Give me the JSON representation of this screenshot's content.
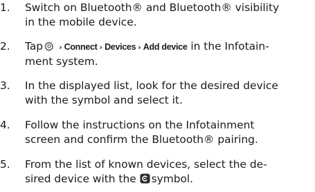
{
  "steps": [
    {
      "number": "1.",
      "lines": [
        "Switch on Bluetooth® and Bluetooth® visibility",
        "in the mobile device."
      ]
    },
    {
      "number": "2.",
      "tap": "Tap",
      "path": [
        "Connect",
        "Devices",
        "Add device"
      ],
      "arrow": "›",
      "after": "in the Infotain-",
      "line2": "ment system.",
      "icon": "settings-gear-icon"
    },
    {
      "number": "3.",
      "lines": [
        "In the displayed list, look for the desired device",
        "with the symbol and select it."
      ]
    },
    {
      "number": "4.",
      "lines": [
        "Follow the instructions on the Infotainment",
        "screen and confirm the Bluetooth® pairing."
      ]
    },
    {
      "number": "5.",
      "line1": "From the list of known devices, select the de-",
      "line2_before": "sired device with the",
      "line2_after": "symbol.",
      "icon": "connected-device-symbol-icon"
    }
  ]
}
